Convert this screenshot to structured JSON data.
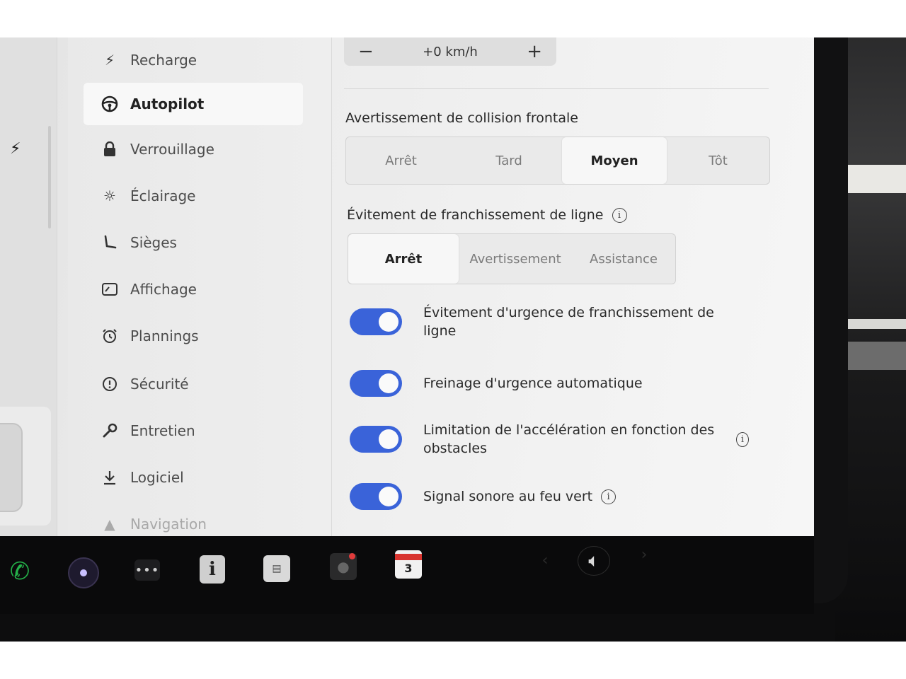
{
  "nav": {
    "items": [
      {
        "label": "Recharge",
        "icon": "lightning-icon"
      },
      {
        "label": "Autopilot",
        "icon": "steering-wheel-icon",
        "active": true
      },
      {
        "label": "Verrouillage",
        "icon": "lock-icon"
      },
      {
        "label": "Éclairage",
        "icon": "sun-icon"
      },
      {
        "label": "Sièges",
        "icon": "seat-icon"
      },
      {
        "label": "Affichage",
        "icon": "display-icon"
      },
      {
        "label": "Plannings",
        "icon": "alarm-clock-icon"
      },
      {
        "label": "Sécurité",
        "icon": "warning-circle-icon"
      },
      {
        "label": "Entretien",
        "icon": "wrench-icon"
      },
      {
        "label": "Logiciel",
        "icon": "download-icon"
      },
      {
        "label": "Navigation",
        "icon": "navigation-arrow-icon"
      }
    ]
  },
  "speed_offset": {
    "value": "+0 km/h",
    "minus": "−",
    "plus": "+"
  },
  "collision_warning": {
    "title": "Avertissement de collision frontale",
    "options": [
      "Arrêt",
      "Tard",
      "Moyen",
      "Tôt"
    ],
    "selected": "Moyen"
  },
  "lane_departure": {
    "title": "Évitement de franchissement de ligne",
    "info": "i",
    "options": [
      "Arrêt",
      "Avertissement",
      "Assistance"
    ],
    "selected": "Arrêt"
  },
  "toggles": [
    {
      "label": "Évitement d'urgence de franchissement de ligne",
      "on": true,
      "info": false
    },
    {
      "label": "Freinage d'urgence automatique",
      "on": true,
      "info": false
    },
    {
      "label": "Limitation de l'accélération en fonction des obstacles",
      "on": true,
      "info": true
    },
    {
      "label": "Signal sonore au feu vert",
      "on": true,
      "info": true
    }
  ],
  "info_glyph": "i",
  "taskbar": {
    "calendar_day": "3",
    "dots_glyph": "•••",
    "info_glyph": "i"
  },
  "colors": {
    "toggle_on": "#3a63d9",
    "phone": "#25b24a",
    "calendar_header": "#d8342f"
  }
}
